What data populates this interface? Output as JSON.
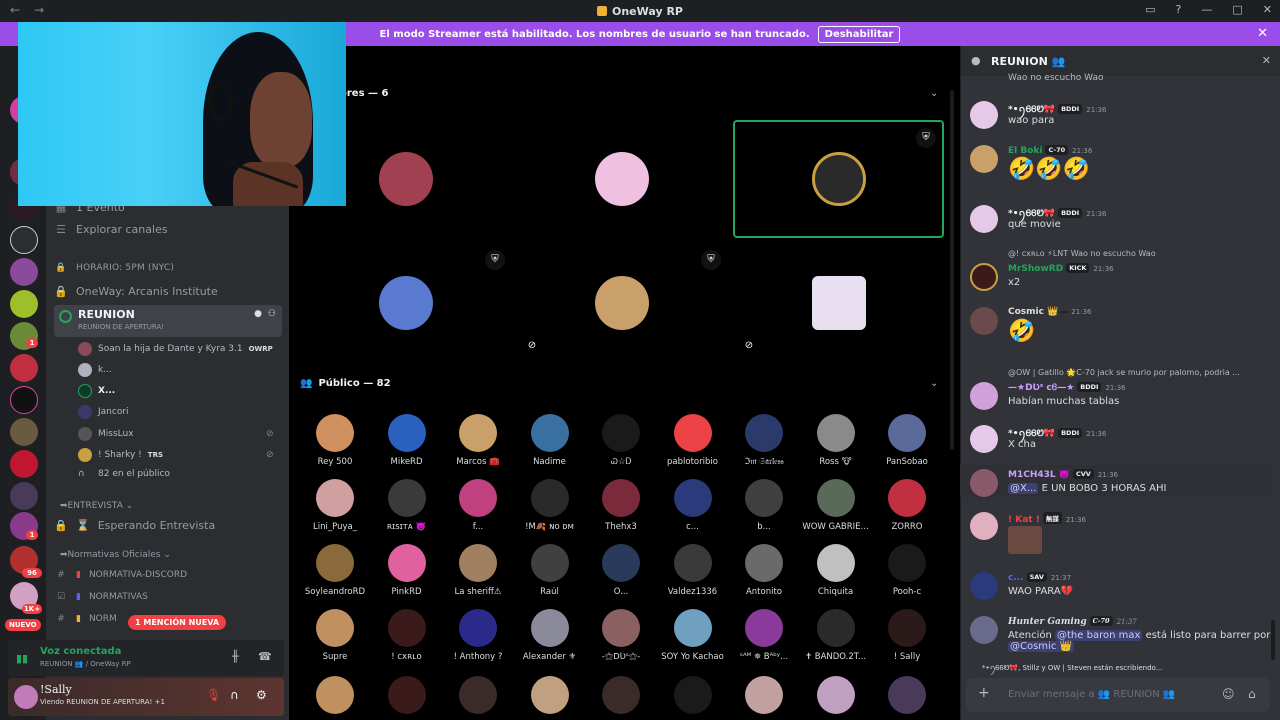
{
  "window": {
    "title": "OneWay RP",
    "back": "←",
    "forward": "→"
  },
  "banner": {
    "text": "El modo Streamer está habilitado. Los nombres de usuario se han truncado.",
    "button": "Deshabilitar"
  },
  "guild_badges": [
    {
      "count": "1"
    },
    {
      "count": "1"
    },
    {
      "count": "96"
    },
    {
      "count": "1K+"
    }
  ],
  "guild_nuevo": "NUEVO",
  "sidebar": {
    "events": "1 Evento",
    "explore": "Explorar canales",
    "schedule": "HORARIO: 5PM (NYC)",
    "institute": "OneWay: Arcanis Institute",
    "voice_channel": {
      "name": "REUNION",
      "status": "REUNION DE APERTURA!"
    },
    "voice_users": [
      {
        "name": "Soan la hija de Dante y Kyra 3.1",
        "tag": "OWRP"
      },
      {
        "name": "k..."
      },
      {
        "name": "X..."
      },
      {
        "name": "Jancori"
      },
      {
        "name": "MissLux"
      },
      {
        "name": "! Sharky !",
        "tag": "TRS"
      }
    ],
    "public_count": "82 en el público",
    "cat_entrevista": "ENTREVISTA",
    "waiting": "Esperando Entrevista",
    "cat_normativas": "Normativas Oficiales",
    "normativa_discord": "NORMATIVA-DISCORD",
    "normativas": "NORMATIVAS",
    "norm_partial": "NORM",
    "mention_badge": "1 MENCIÓN NUEVA"
  },
  "voice_connection": {
    "status": "Voz conectada",
    "location": "REUNION 👥 / OneWay RP"
  },
  "user_panel": {
    "name": "!Sally",
    "status": "Viendo REUNION DE APERTURA! +1"
  },
  "stage": {
    "speakers_header": "ores — 6",
    "audience_header": "Público — 82",
    "speaker_colors": [
      "#3d2a2a",
      "#c9bdb0",
      "#5b8fd1",
      "#1b2257",
      "#e0b528",
      "#b0aeb0"
    ],
    "audience": [
      "Rey 500",
      "MikeRD",
      "Marcos 🧰",
      "Nadime",
      "Ꮗ☆Ꭰ",
      "pablotoribio",
      "ℑ𝔪 𝔖𝔞𝔯𝔩𝔢𝔰𝔰",
      "Ross 🐮",
      "PanSobao",
      "Lini_Puya_",
      "ʀɪsɪᴛᴀ 👿",
      "f...",
      "!M🍂 ɴᴏ ᴅᴍ",
      "Thehx3",
      "c...",
      "b...",
      "WOW GABRIE...",
      "ZORRO",
      "SoyleandroRD",
      "PinkRD",
      "La sheriff⚠",
      "Raúl",
      "O...",
      "Valdez1336",
      "Antonito",
      "Chiquita",
      "Pooh-c",
      "Supre",
      "! ᴄxʀʟᴏ",
      "! Anthony ?",
      "Alexander ⚜",
      "-⚝ꓓƲˢ⚝-",
      "SOY Yo Kachao",
      "ˢᴬᴹ ✵ Bᴬᵇʸ...",
      "✝ BANDO.2T...",
      "! Sally"
    ]
  },
  "chat": {
    "title": "REUNION 👥",
    "top_fragment": "Wao no escucho Wao",
    "messages": [
      {
        "name": "*•ꪆᏮᏮᏬ🎀",
        "role": "BDDI",
        "time": "21:36",
        "text": "wao para"
      },
      {
        "name": "El Boki",
        "role": "C-70",
        "time": "21:36",
        "text": "🤣🤣🤣"
      },
      {
        "name": "*•ꪆᏮᏮᏬ🎀",
        "role": "BDDI",
        "time": "21:36",
        "text": "que movie"
      },
      {
        "name": "MrShowRD",
        "role": "KICK",
        "time": "21:36",
        "text": "x2",
        "reply": "@! ᴄxʀʟᴏ ⚡LNT Wao no escucho Wao"
      },
      {
        "name": "Cosmic 👑",
        "role": "",
        "time": "21:36",
        "text": "🤣"
      },
      {
        "name": "—★ꓓƲˢ ᴄᏮ—★",
        "role": "BDDI",
        "time": "21:36",
        "text": "Habían muchas tablas",
        "reply": "@OW | Gatillo 🌟C-70 jack se murio por palomo, podria ..."
      },
      {
        "name": "*•ꪆᏮᏮᏬ🎀",
        "role": "BDDI",
        "time": "21:36",
        "text": "X cha"
      },
      {
        "name": "M1CH43L 👿",
        "role": "CVV",
        "time": "21:36",
        "text": "E UN BOBO 3 HORAS AHI",
        "mention": "@X..."
      },
      {
        "name": "! Kat !",
        "role": "無謀",
        "time": "21:36",
        "text": ""
      },
      {
        "name": "c...",
        "role": "SAV",
        "time": "21:37",
        "text": "WAO PARA💔"
      },
      {
        "name": "Hunter Gaming",
        "role": "C-70",
        "time": "21:37",
        "text_pre": "Atención ",
        "mention1": "@the baron max",
        "text_mid": " está listo para barrer por ",
        "mention2": "@Cosmic 👑"
      }
    ],
    "typing": "*•ꪆᏮᏮᏬ🎀, Stillz y OW | Steven están escribiendo...",
    "input_placeholder": "Enviar mensaje a 👥 REUNION 👥"
  }
}
